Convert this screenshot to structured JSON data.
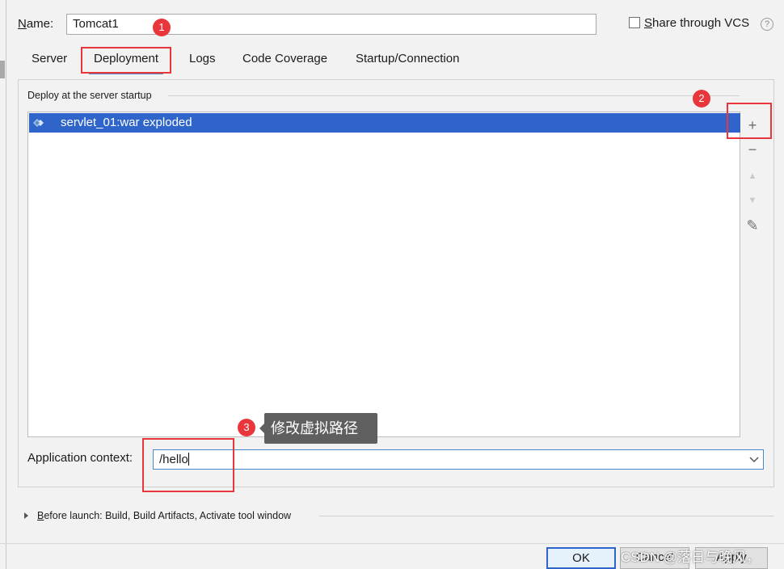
{
  "name_field": {
    "label_prefix": "N",
    "label_rest": "ame:",
    "value": "Tomcat1"
  },
  "share_vcs": {
    "label_prefix": "S",
    "label_rest": "hare through VCS",
    "checked": false,
    "help_glyph": "?"
  },
  "tabs": [
    {
      "label": "Server",
      "active": false
    },
    {
      "label": "Deployment",
      "active": true
    },
    {
      "label": "Logs",
      "active": false
    },
    {
      "label": "Code Coverage",
      "active": false
    },
    {
      "label": "Startup/Connection",
      "active": false
    }
  ],
  "deployment": {
    "group_title": "Deploy at the server startup",
    "items": [
      {
        "label": "servlet_01:war exploded",
        "icon": "artifact-icon",
        "selected": true
      }
    ],
    "toolbar": [
      {
        "icon": "add-icon",
        "glyph": "+",
        "enabled": true
      },
      {
        "icon": "remove-icon",
        "glyph": "−",
        "enabled": true
      },
      {
        "icon": "move-up-icon",
        "glyph": "▲",
        "enabled": false
      },
      {
        "icon": "move-down-icon",
        "glyph": "▼",
        "enabled": false
      },
      {
        "icon": "edit-icon",
        "glyph": "✎",
        "enabled": true
      }
    ]
  },
  "application_context": {
    "label": "Application context:",
    "value": "/hello"
  },
  "before_launch": {
    "label_prefix": "B",
    "label_rest": "efore launch: Build, Build Artifacts, Activate tool window"
  },
  "buttons": {
    "ok": "OK",
    "cancel": "Cancel",
    "apply": "Apply"
  },
  "annotations": {
    "badge_1": "1",
    "badge_2": "2",
    "badge_3": "3",
    "tooltip": "修改虚拟路径",
    "highlight_color": "#e8363a"
  },
  "watermark": "CSDN @落日与晚风，",
  "colors": {
    "selection": "#2f65ca",
    "focus": "#4a88c7"
  }
}
